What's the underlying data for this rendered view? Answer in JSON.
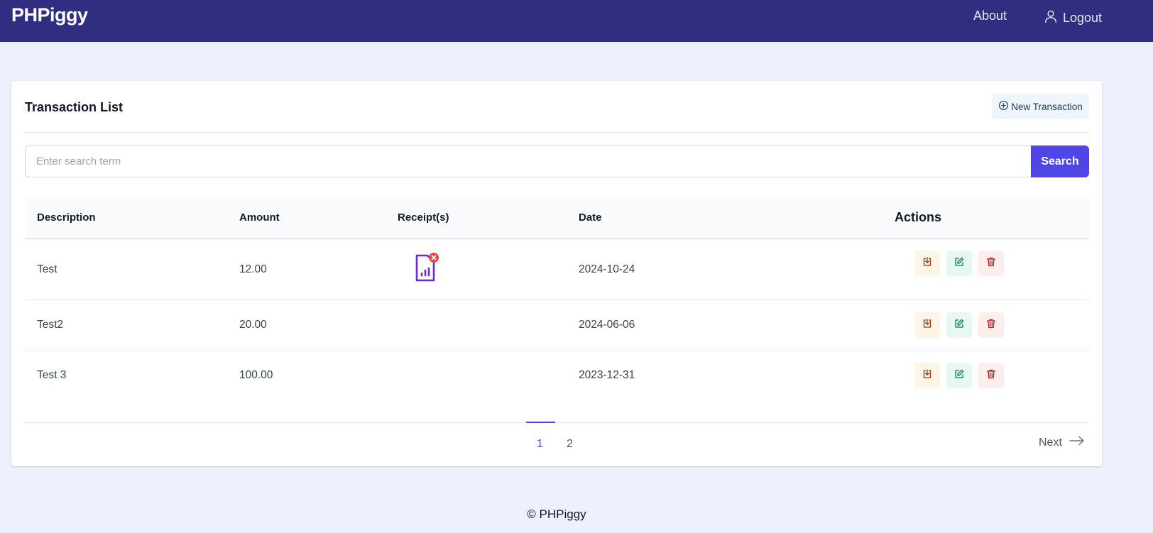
{
  "header": {
    "brand": "PHPiggy",
    "nav": {
      "about": "About",
      "logout": "Logout"
    }
  },
  "card": {
    "title": "Transaction List",
    "new_transaction_label": "New Transaction"
  },
  "search": {
    "placeholder": "Enter search term",
    "value": "",
    "button_label": "Search"
  },
  "table": {
    "columns": [
      "Description",
      "Amount",
      "Receipt(s)",
      "Date",
      "Actions"
    ],
    "rows": [
      {
        "description": "Test",
        "amount": "12.00",
        "has_receipt": true,
        "date": "2024-10-24"
      },
      {
        "description": "Test2",
        "amount": "20.00",
        "has_receipt": false,
        "date": "2024-06-06"
      },
      {
        "description": "Test 3",
        "amount": "100.00",
        "has_receipt": false,
        "date": "2023-12-31"
      }
    ],
    "action_icons": [
      "download-icon",
      "edit-icon",
      "trash-icon"
    ]
  },
  "pagination": {
    "pages": [
      "1",
      "2"
    ],
    "current": "1",
    "next_label": "Next"
  },
  "footer": {
    "text": "© PHPiggy"
  },
  "colors": {
    "topbar": "#312e81",
    "accent": "#4f46e5",
    "background": "#edf1fd",
    "receipt_icon": "#6d28d9",
    "receipt_badge": "#ef4444"
  }
}
